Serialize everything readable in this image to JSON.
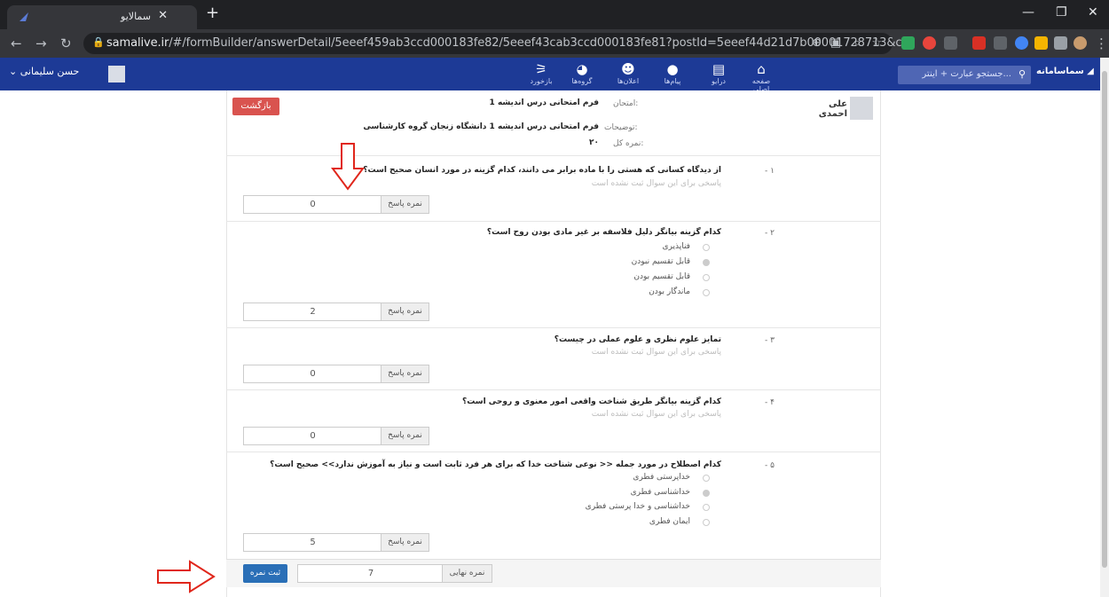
{
  "browser": {
    "tab_title": "سمالایو",
    "url_domain": "samalive.ir",
    "url_rest": "/#/formBuilder/answerDetail/5eeef459ab3ccd000183fe82/5eeef43cab3ccd000183fe81?postId=5eeef44d21d7b00001728713&c..."
  },
  "nav": {
    "items": [
      {
        "label": "صفحه اصلی",
        "icon": "home-icon"
      },
      {
        "label": "درایو",
        "icon": "drive-icon"
      },
      {
        "label": "پیام‌ها",
        "icon": "chat-icon"
      },
      {
        "label": "اعلان‌ها",
        "icon": "bell-icon"
      },
      {
        "label": "گروه‌ها",
        "icon": "groups-icon"
      },
      {
        "label": "بازخورد",
        "icon": "feedback-icon"
      }
    ],
    "search_placeholder": "جستجو عبارت + اینتر...",
    "logo": "سماسامانه",
    "user_name": "حسن سلیمانی"
  },
  "exam": {
    "author": "علی احمدی",
    "back_label": "بازگشت",
    "exam_label": "امتحان:",
    "exam_value": "فرم امتحانی درس اندیشه 1",
    "desc_label": "توضیحات:",
    "desc_value": "فرم امتحانی درس اندیشه 1 دانشگاه زنجان گروه کارشناسی",
    "total_label": "نمره کل:",
    "total_value": "۲۰"
  },
  "score_addon": "نمره پاسخ",
  "no_answer": "پاسخی برای این سوال ثبت نشده است",
  "questions": [
    {
      "num": "- ۱",
      "text": "از دیدگاه کسانی که هستی را با ماده برابر می دانند، کدام گزینه در مورد انسان صحیح است؟",
      "score": "0"
    },
    {
      "num": "- ۲",
      "text": "کدام گزینه بیانگر دلیل فلاسفه بر غیر مادی بودن روح است؟",
      "score": "2",
      "options": [
        "فناپذیری",
        "قابل تقسیم نبودن",
        "قابل تقسیم بودن",
        "ماندگار بودن"
      ]
    },
    {
      "num": "- ۳",
      "text": "تمایز علوم نظری و علوم عملی در چیست؟",
      "score": "0"
    },
    {
      "num": "- ۴",
      "text": "کدام گزینه بیانگر طریق شناخت واقعی امور معنوی و روحی است؟",
      "score": "0"
    },
    {
      "num": "- ۵",
      "text": "کدام اصطلاح در مورد جمله << نوعی شناخت خدا که برای هر فرد ثابت است و نیاز به آموزش ندارد>> صحیح است؟",
      "score": "5",
      "options": [
        "خداپرستی فطری",
        "خداشناسی فطری",
        "خداشناسی و خدا پرستی فطری",
        "ایمان فطری"
      ]
    }
  ],
  "footer": {
    "final_label": "نمره نهایی",
    "final_value": "7",
    "submit_label": "ثبت نمره"
  },
  "colors": {
    "nav": "#1d3a96",
    "back": "#d9534f",
    "submit": "#2a6fb7",
    "arrow": "#e0261b"
  }
}
